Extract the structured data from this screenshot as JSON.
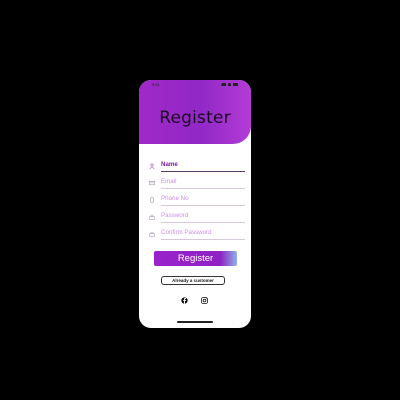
{
  "status_bar": {
    "time": "9:41"
  },
  "header": {
    "title": "Register"
  },
  "form": {
    "fields": [
      {
        "label": "Name",
        "icon": "user-icon"
      },
      {
        "label": "Email",
        "icon": "mail-icon"
      },
      {
        "label": "Phone No",
        "icon": "phone-icon"
      },
      {
        "label": "Password",
        "icon": "lock-icon"
      },
      {
        "label": "Confirm Password",
        "icon": "lock-icon"
      }
    ],
    "register_label": "Register",
    "already_customer_label": "Already a customer"
  },
  "social": {
    "icons": [
      "facebook-icon",
      "instagram-icon"
    ]
  },
  "colors": {
    "accent": "#9a22cc",
    "field_label": "#c98ee0",
    "background": "#000000"
  }
}
